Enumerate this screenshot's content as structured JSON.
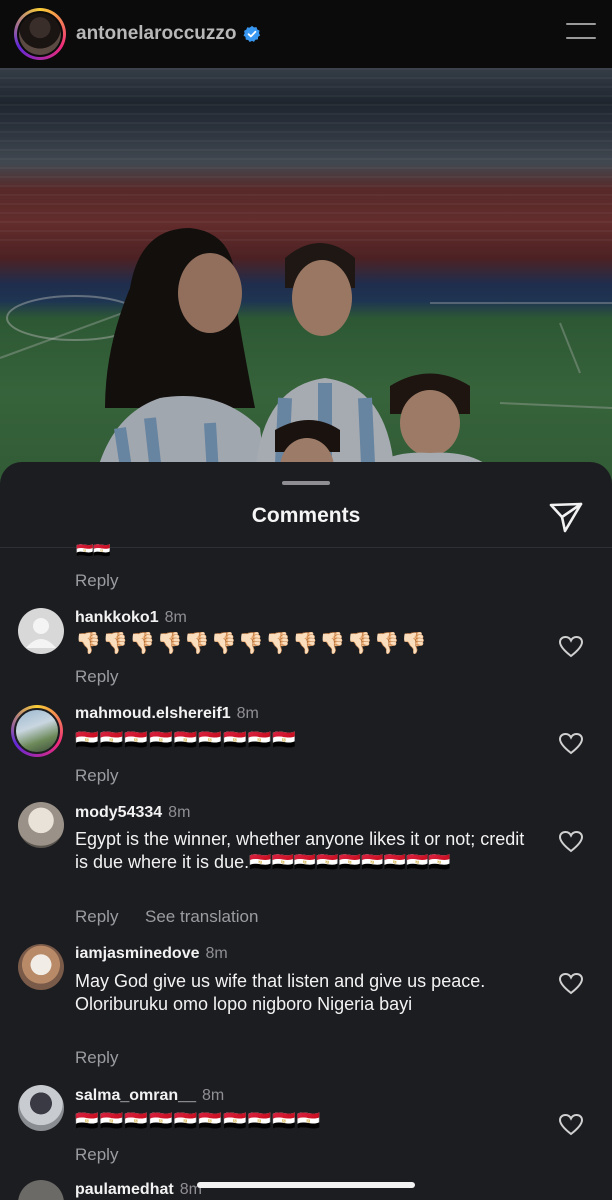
{
  "header": {
    "username": "antonelaroccuzzo",
    "verified_icon": "verified-badge-icon",
    "menu_icon": "hamburger-menu-icon"
  },
  "sheet": {
    "title": "Comments",
    "share_icon": "send-icon",
    "partial_text": "🇪🇬🇪🇬"
  },
  "labels": {
    "reply": "Reply",
    "see_translation": "See translation"
  },
  "comments": [
    {
      "username": "hankkoko1",
      "time": "8m",
      "text": "👎🏻👎🏻👎🏻👎🏻👎🏻👎🏻👎🏻👎🏻👎🏻👎🏻👎🏻👎🏻👎🏻"
    },
    {
      "username": "mahmoud.elshereif1",
      "time": "8m",
      "text": "🇪🇬🇪🇬🇪🇬🇪🇬🇪🇬🇪🇬🇪🇬🇪🇬🇪🇬"
    },
    {
      "username": "mody54334",
      "time": "8m",
      "text": "Egypt is the winner, whether anyone likes it or not; credit is due where it is due.🇪🇬🇪🇬🇪🇬🇪🇬🇪🇬🇪🇬🇪🇬🇪🇬🇪🇬"
    },
    {
      "username": "iamjasminedove",
      "time": "8m",
      "text": "May God give us wife that listen and give us peace.  Oloriburuku omo lopo nigboro Nigeria bayi"
    },
    {
      "username": "salma_omran__",
      "time": "8m",
      "text": "🇪🇬🇪🇬🇪🇬🇪🇬🇪🇬🇪🇬🇪🇬🇪🇬🇪🇬🇪🇬"
    },
    {
      "username": "paulamedhat",
      "time": "8m"
    }
  ],
  "colors": {
    "sheet_bg": "#1c1d21",
    "secondary_text": "#9b9ca1",
    "verified_blue": "#3897f0"
  }
}
